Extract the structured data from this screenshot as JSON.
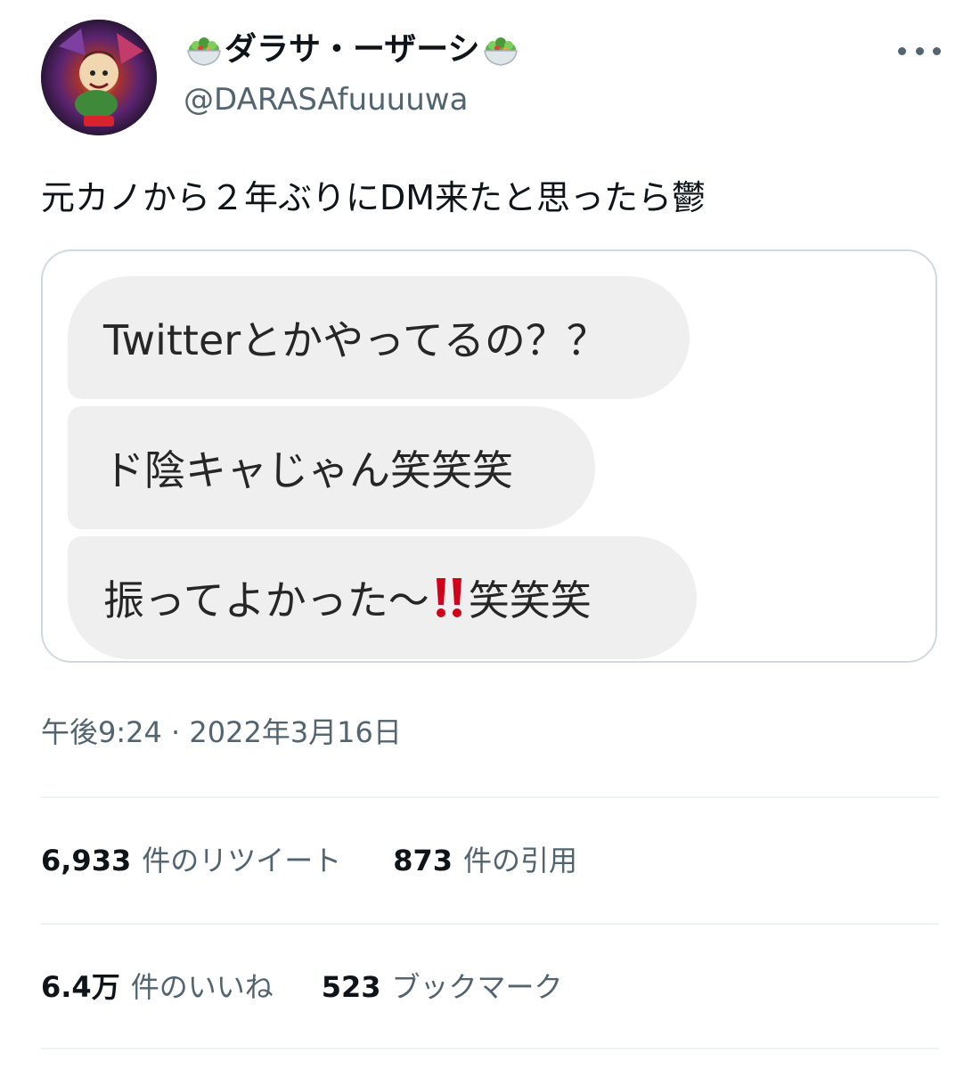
{
  "user": {
    "display_name": "ダラサ・ーザーシ",
    "handle": "@DARASAfuuuuwa",
    "name_prefix_icon": "salad-icon",
    "name_suffix_icon": "salad-icon"
  },
  "header": {
    "more_icon": "ellipsis-icon"
  },
  "tweet": {
    "text": "元カノから２年ぶりにDM来たと思ったら鬱",
    "timestamp": "午後9:24 · 2022年3月16日"
  },
  "media": {
    "messages": [
      {
        "text": "Twitterとかやってるの？？"
      },
      {
        "text": "ド陰キャじゃん笑笑笑"
      },
      {
        "text_before": "振ってよかった〜",
        "icon": "double-exclamation-icon",
        "text_after": "笑笑笑"
      }
    ]
  },
  "stats": {
    "retweets_count": "6,933",
    "retweets_label": "件のリツイート",
    "quotes_count": "873",
    "quotes_label": "件の引用",
    "likes_count": "6.4万",
    "likes_label": "件のいいね",
    "bookmarks_count": "523",
    "bookmarks_label": "ブックマーク"
  },
  "colors": {
    "text_primary": "#0f1419",
    "text_secondary": "#536471",
    "bubble_bg": "#efefef",
    "card_border": "#cfd9de",
    "exclamation_red": "#d0021b"
  }
}
